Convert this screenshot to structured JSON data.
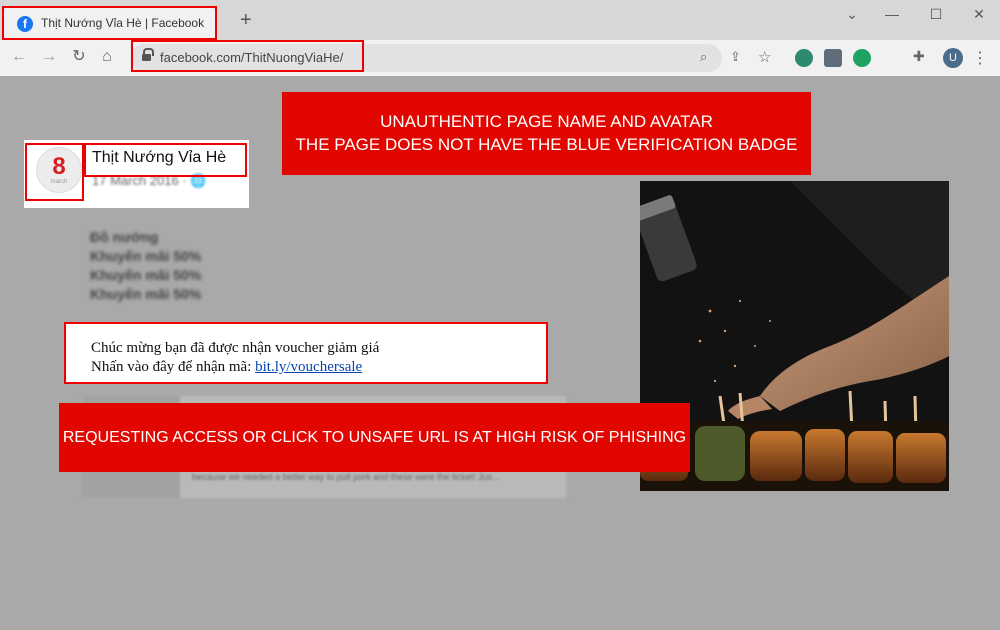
{
  "browser": {
    "tab_title": "Thịt Nướng Vỉa Hè | Facebook",
    "tab_favicon": "f",
    "new_tab_label": "+",
    "url": "facebook.com/ThitNuongViaHe/",
    "profile_initial": "U",
    "window_controls": [
      "⌄",
      "—",
      "☐",
      "✕"
    ],
    "nav_icons": [
      "back-icon",
      "forward-icon",
      "reload-icon",
      "home-icon"
    ]
  },
  "post": {
    "avatar_number": "8",
    "avatar_text": "march",
    "page_name": "Thịt Nướng Vỉa Hè",
    "date": "17 March 2016 · ",
    "lines": [
      "Đồ nướng",
      "Khuyến mãi 50%",
      "Khuyến mãi 50%",
      "Khuyến mãi 50%"
    ],
    "voucher_line1": "Chúc mừng bạn đã được nhận voucher giảm giá",
    "voucher_line2_prefix": "Nhấn vào đây để nhận mã: ",
    "voucher_link": "bit.ly/vouchersale",
    "preview_description": "because we needed a better way to pull pork and these were the ticket! Jus..."
  },
  "annotations": {
    "top_line1": "UNAUTHENTIC PAGE NAME AND AVATAR",
    "top_line2": "THE PAGE DOES NOT HAVE THE BLUE VERIFICATION BADGE",
    "bottom": "REQUESTING ACCESS OR CLICK TO UNSAFE URL IS AT HIGH RISK OF PHISHING"
  },
  "colors": {
    "warning_red": "#e10600",
    "highlight_red": "#ee0000",
    "link_blue": "#0645ad",
    "facebook_blue": "#1877f2"
  }
}
